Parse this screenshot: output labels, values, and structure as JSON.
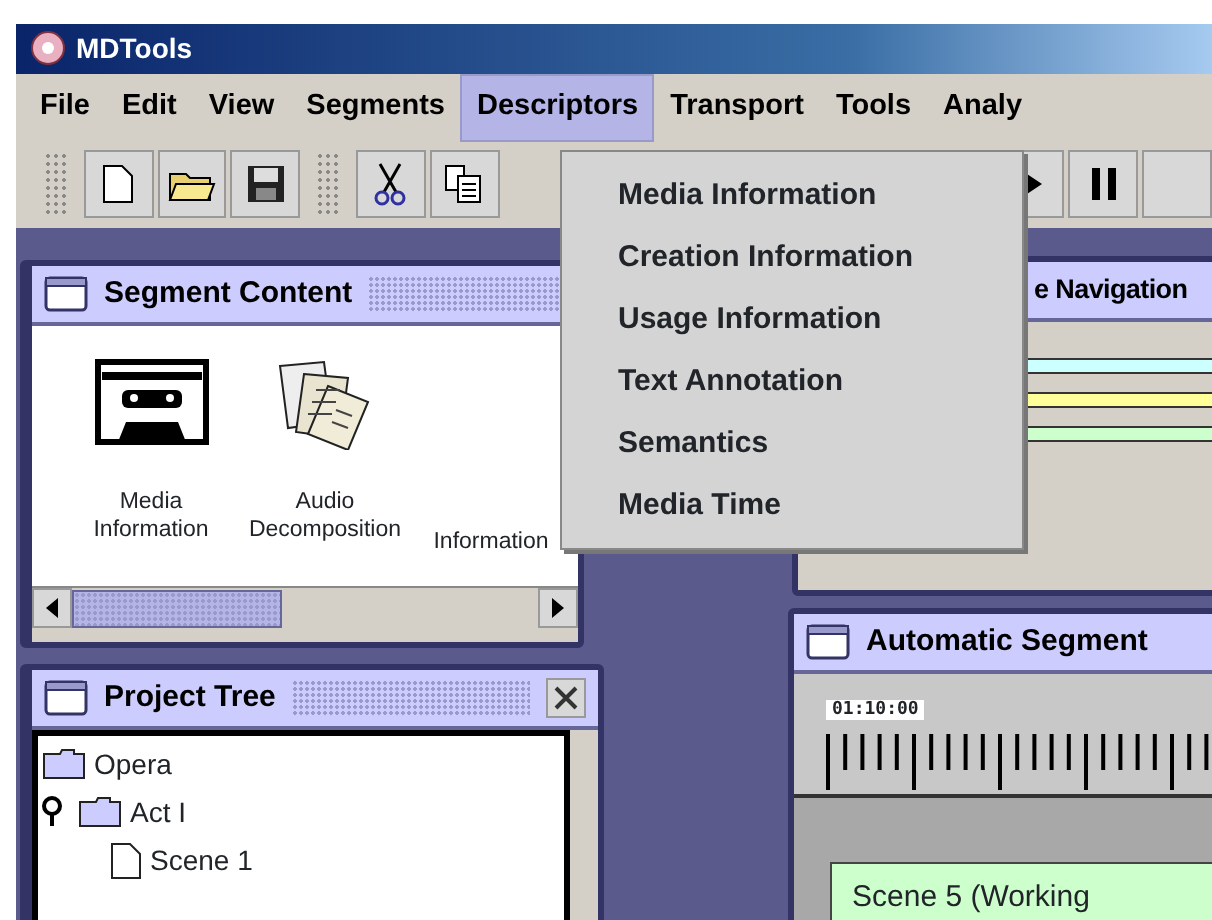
{
  "window": {
    "title": "MDTools"
  },
  "menu_bar": [
    {
      "label": "File",
      "selected": false
    },
    {
      "label": "Edit",
      "selected": false
    },
    {
      "label": "View",
      "selected": false
    },
    {
      "label": "Segments",
      "selected": false
    },
    {
      "label": "Descriptors",
      "selected": true
    },
    {
      "label": "Transport",
      "selected": false
    },
    {
      "label": "Tools",
      "selected": false
    },
    {
      "label": "Analy",
      "selected": false
    }
  ],
  "open_menu": {
    "items": [
      "Media Information",
      "Creation Information",
      "Usage Information",
      "Text Annotation",
      "Semantics",
      "Media Time"
    ]
  },
  "segment_content": {
    "title": "Segment Content",
    "items": [
      {
        "kind": "cassette",
        "label": "Media\nInformation"
      },
      {
        "kind": "papers",
        "label": "Audio\nDecomposition"
      },
      {
        "kind": "hidden",
        "label": "Information"
      }
    ]
  },
  "navigation": {
    "title": "e Navigation",
    "tracks": [
      {
        "color": "#ccffff"
      },
      {
        "color": "#ffff99"
      },
      {
        "color": "#ccffcc"
      }
    ]
  },
  "project_tree": {
    "title": "Project Tree",
    "items": [
      {
        "label": "Opera",
        "kind": "folder"
      },
      {
        "label": "Act I",
        "kind": "folder",
        "expanded": true,
        "children": [
          {
            "label": "Scene 1",
            "kind": "document"
          }
        ]
      }
    ]
  },
  "automatic_segmentation": {
    "title": "Automatic Segment",
    "time_label": "01:10:00",
    "segment": "Scene 5 (Working"
  }
}
